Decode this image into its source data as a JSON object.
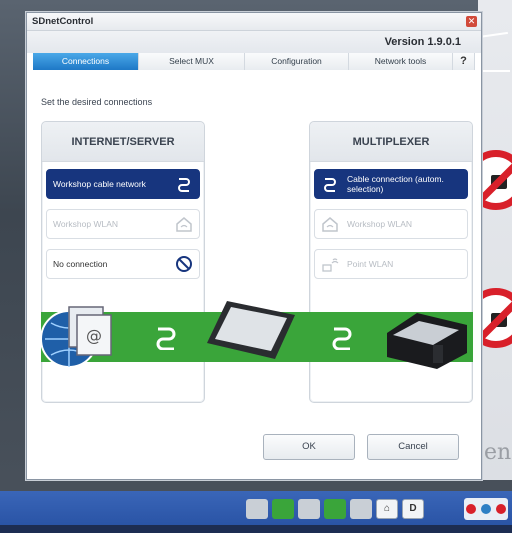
{
  "window": {
    "title": "SDnetControl",
    "close_glyph": "✕",
    "version": "Version 1.9.0.1"
  },
  "tabs": [
    {
      "label": "Connections",
      "active": true
    },
    {
      "label": "Select MUX",
      "active": false
    },
    {
      "label": "Configuration",
      "active": false
    },
    {
      "label": "Network tools",
      "active": false
    },
    {
      "label": "?",
      "active": false
    }
  ],
  "instruction": "Set the desired connections",
  "internet_server": {
    "header": "INTERNET/SERVER",
    "options": [
      {
        "label": "Workshop cable network",
        "icon": "cable-link-icon",
        "state": "selected"
      },
      {
        "label": "Workshop WLAN",
        "icon": "house-wlan-icon",
        "state": "disabled"
      },
      {
        "label": "No connection",
        "icon": "no-connection-icon",
        "state": "enabled"
      }
    ]
  },
  "multiplexer": {
    "header": "MULTIPLEXER",
    "options": [
      {
        "label": "Cable connection (autom. selection)",
        "icon": "cable-link-icon",
        "state": "selected"
      },
      {
        "label": "Workshop WLAN",
        "icon": "house-wlan-icon",
        "state": "disabled"
      },
      {
        "label": "Point WLAN",
        "icon": "point-wlan-icon",
        "state": "disabled"
      }
    ]
  },
  "diagram": {
    "left_device": "globe-server-icon",
    "center_device": "tablet-icon",
    "right_device": "multiplexer-icon",
    "link_icon": "cable-link-icon",
    "bar_color": "#3aa53a"
  },
  "buttons": {
    "ok": "OK",
    "cancel": "Cancel"
  },
  "background": {
    "partial_text": "en"
  },
  "taskbar": {
    "tray_letter": "D"
  },
  "colors": {
    "accent": "#2e7fc4",
    "selected_option": "#17357e",
    "taskbar": "#2a54a6"
  }
}
